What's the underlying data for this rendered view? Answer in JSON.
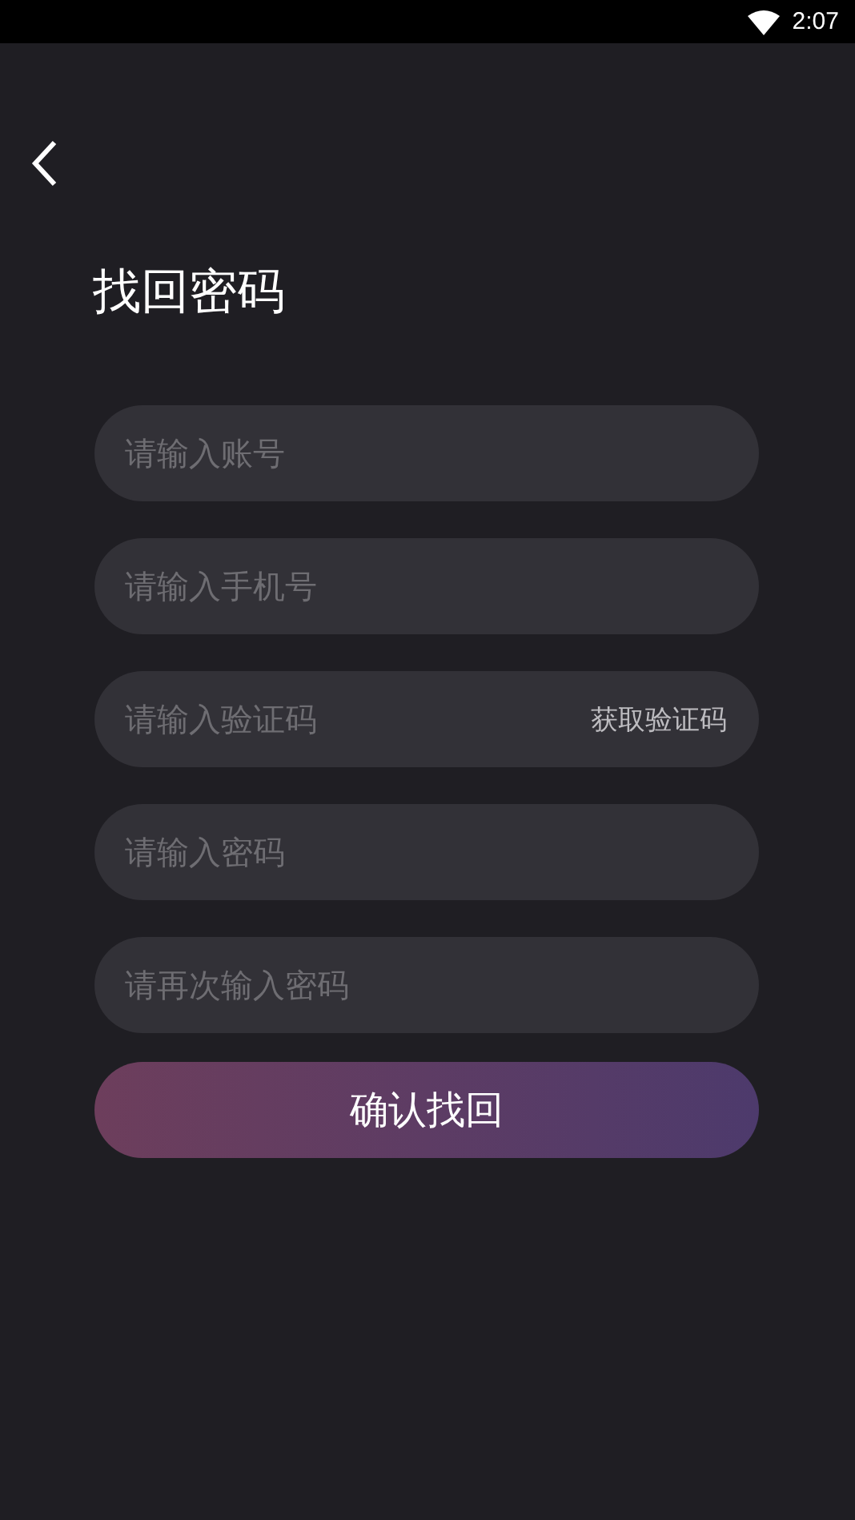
{
  "status_bar": {
    "time": "2:07"
  },
  "title": "找回密码",
  "fields": [
    {
      "placeholder": "请输入账号"
    },
    {
      "placeholder": "请输入手机号"
    },
    {
      "placeholder": "请输入验证码",
      "action": "获取验证码"
    },
    {
      "placeholder": "请输入密码"
    },
    {
      "placeholder": "请再次输入密码"
    }
  ],
  "submit": "确认找回"
}
